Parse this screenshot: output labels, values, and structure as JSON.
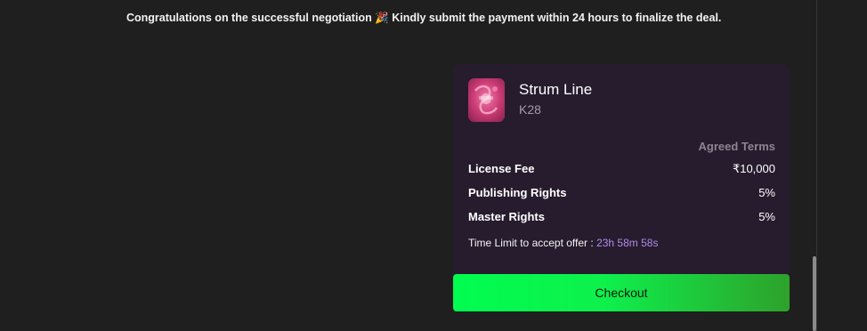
{
  "message": {
    "text": "Congratulations on the successful negotiation 🎉 Kindly submit the payment within 24 hours to finalize the deal."
  },
  "deal_card": {
    "title": "Strum Line",
    "subtitle": "K28",
    "agreed_terms_label": "Agreed Terms",
    "terms": [
      {
        "label": "License Fee",
        "value": "₹10,000"
      },
      {
        "label": "Publishing Rights",
        "value": "5%"
      },
      {
        "label": "Master Rights",
        "value": "5%"
      }
    ],
    "time_limit_label": "Time Limit to accept offer :",
    "time_limit_value": "23h 58m 58s"
  },
  "checkout": {
    "label": "Checkout"
  },
  "colors": {
    "background": "#1f1f1f",
    "card": "#261c2e",
    "accent_purple": "#b48ae8",
    "button_green": "#00fd4f",
    "button_green_dark": "#2ea12b"
  }
}
